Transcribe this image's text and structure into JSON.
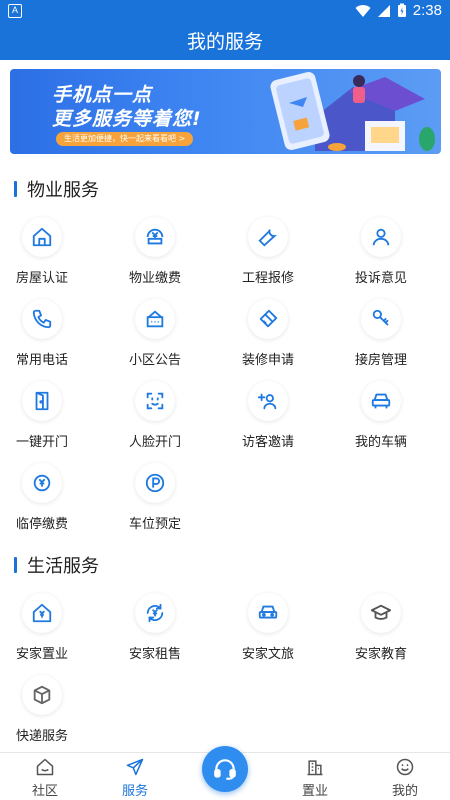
{
  "status_bar": {
    "time": "2:38",
    "left_badge": "A"
  },
  "app_bar": {
    "title": "我的服务"
  },
  "banner": {
    "line1": "手机点一点",
    "line2": "更多服务等着您!",
    "pill": "生活更加便捷，快一起来看看吧 >"
  },
  "property_services": {
    "title": "物业服务",
    "items": [
      {
        "label": "房屋认证",
        "icon": "house-icon"
      },
      {
        "label": "物业缴费",
        "icon": "payment-icon"
      },
      {
        "label": "工程报修",
        "icon": "wrench-icon"
      },
      {
        "label": "投诉意见",
        "icon": "user-icon"
      },
      {
        "label": "常用电话",
        "icon": "phone-icon"
      },
      {
        "label": "小区公告",
        "icon": "notice-icon"
      },
      {
        "label": "装修申请",
        "icon": "paint-roller-icon"
      },
      {
        "label": "接房管理",
        "icon": "key-icon"
      },
      {
        "label": "一键开门",
        "icon": "door-icon"
      },
      {
        "label": "人脸开门",
        "icon": "face-scan-icon"
      },
      {
        "label": "访客邀请",
        "icon": "add-visitor-icon"
      },
      {
        "label": "我的车辆",
        "icon": "car-icon"
      },
      {
        "label": "临停缴费",
        "icon": "parking-fee-icon"
      },
      {
        "label": "车位预定",
        "icon": "parking-icon"
      }
    ]
  },
  "life_services": {
    "title": "生活服务",
    "items": [
      {
        "label": "安家置业",
        "icon": "home-buy-icon"
      },
      {
        "label": "安家租售",
        "icon": "rent-icon"
      },
      {
        "label": "安家文旅",
        "icon": "travel-car-icon"
      },
      {
        "label": "安家教育",
        "icon": "graduation-cap-icon"
      },
      {
        "label": "快递服务",
        "icon": "package-icon"
      }
    ]
  },
  "tab_bar": {
    "items": [
      {
        "label": "社区",
        "icon": "community-icon",
        "active": false
      },
      {
        "label": "服务",
        "icon": "send-icon",
        "active": true
      },
      {
        "label": "置业",
        "icon": "building-icon",
        "active": false
      },
      {
        "label": "我的",
        "icon": "smile-icon",
        "active": false
      }
    ],
    "center_icon": "headset-icon"
  },
  "colors": {
    "primary": "#1a73d9",
    "accent_orange": "#f6a33b",
    "icon_blue": "#1f7ae0"
  }
}
